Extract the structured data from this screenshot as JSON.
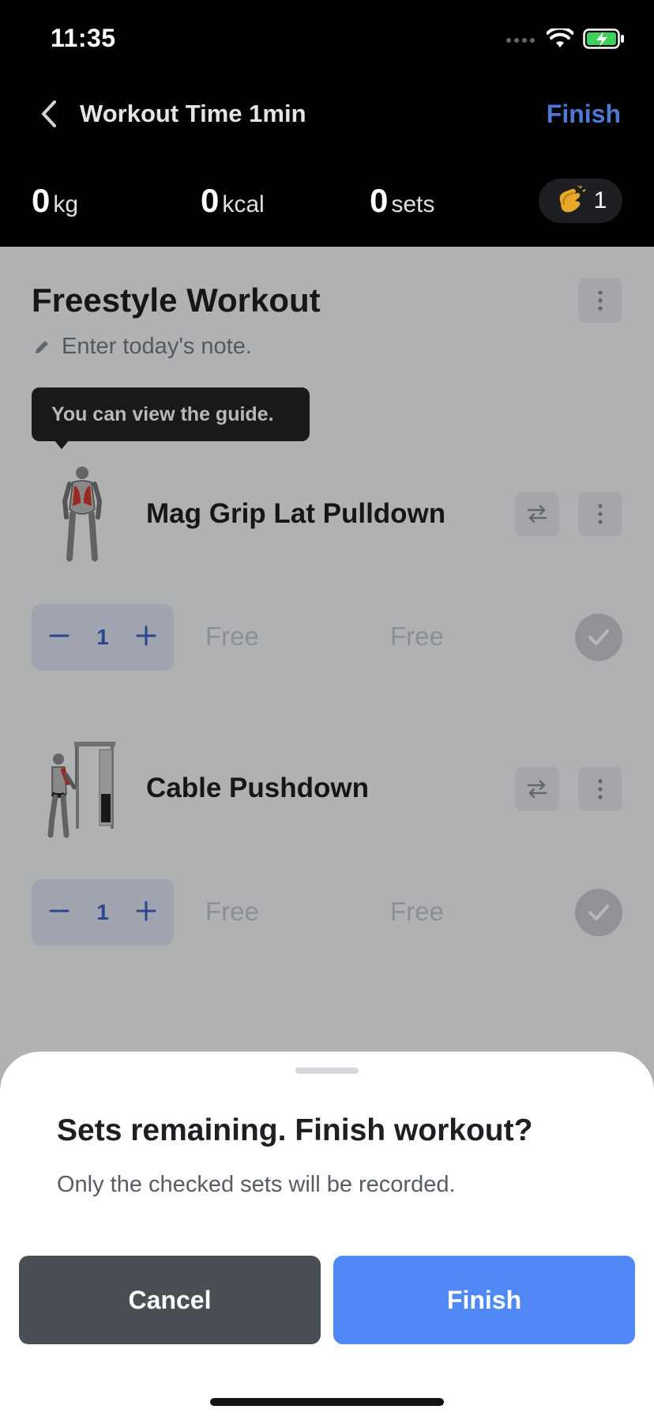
{
  "status": {
    "time": "11:35"
  },
  "header": {
    "workout_time": "Workout Time 1min",
    "finish_label": "Finish"
  },
  "stats": {
    "weight": {
      "value": "0",
      "unit": "kg"
    },
    "calories": {
      "value": "0",
      "unit": "kcal"
    },
    "sets": {
      "value": "0",
      "unit": "sets"
    },
    "claps": {
      "icon": "clapping-hands-icon",
      "count": "1"
    }
  },
  "workout": {
    "title": "Freestyle Workout",
    "note_placeholder": "Enter today's note.",
    "tooltip": "You can view the guide."
  },
  "exercises": [
    {
      "name": "Mag Grip Lat Pulldown",
      "set_count": "1",
      "weight": "Free",
      "reps": "Free"
    },
    {
      "name": "Cable Pushdown",
      "set_count": "1",
      "weight": "Free",
      "reps": "Free"
    }
  ],
  "sheet": {
    "title": "Sets remaining. Finish workout?",
    "subtitle": "Only the checked sets will be recorded.",
    "cancel_label": "Cancel",
    "finish_label": "Finish"
  },
  "colors": {
    "accent": "#5089f5",
    "header_finish": "#4d79d6",
    "cancel": "#4a4e55",
    "muscle_highlight": "#d43a2f"
  }
}
